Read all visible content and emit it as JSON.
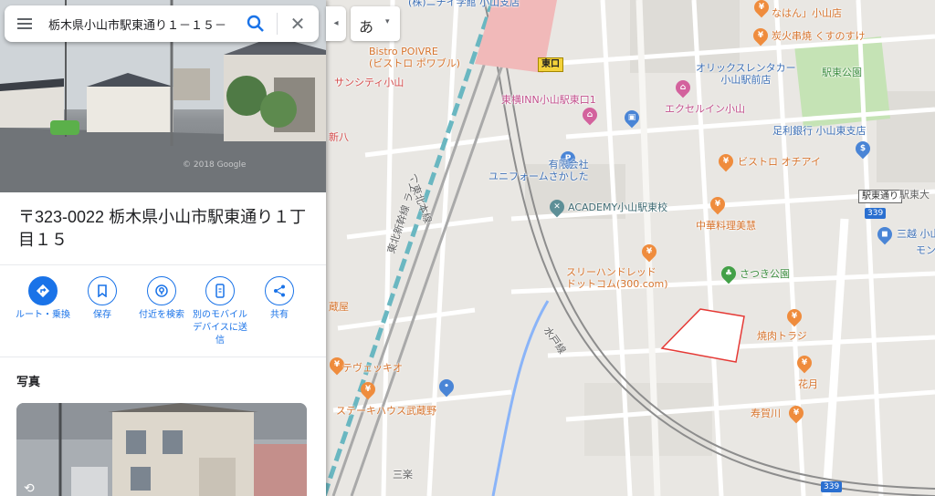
{
  "search": {
    "value": "栃木県小山市駅東通り１－１５－",
    "clear": "✕"
  },
  "ime": {
    "label": "あ",
    "caret": "▾"
  },
  "collapse": {
    "label": "◂"
  },
  "place": {
    "address": "〒323-0022 栃木県小山市駅東通り１丁目１５"
  },
  "actions": [
    {
      "label": "ルート・乗換"
    },
    {
      "label": "保存"
    },
    {
      "label": "付近を検索"
    },
    {
      "label": "別のモバイルデバイスに送信"
    },
    {
      "label": "共有"
    }
  ],
  "photos": {
    "title": "写真"
  },
  "hero": {
    "watermark": "© 2018 Google"
  },
  "map": {
    "labels": {
      "station_exit": "東口",
      "station_east_street": "駅東通り",
      "station_east_street_clipped": "駅東大",
      "route_339": "339",
      "route_339_b": "339",
      "tohoku_main_line": "東北本線",
      "tohoku_shinkansen": "東北新幹線 ライン",
      "mito_line": "水戸線",
      "sanraku": "三楽",
      "shinpachi": "新八",
      "kura": "蔵屋"
    },
    "pois": [
      {
        "name": "(株)ニチイ学館 小山支店",
        "kind": "shop"
      },
      {
        "name": "Bistro POIVRE\n(ビストロ ポワブル)",
        "kind": "food"
      },
      {
        "name": "サンシティ小山",
        "kind": "rail"
      },
      {
        "name": "東横INN小山駅東口1",
        "kind": "hotel"
      },
      {
        "name": "有限会社\nユニフォームさかした",
        "kind": "shop"
      },
      {
        "name": "ACADEMY小山駅東校",
        "kind": "school"
      },
      {
        "name": "スリーハンドレッド\nドットコム(300.com)",
        "kind": "food"
      },
      {
        "name": "テヴェッキオ",
        "kind": "food"
      },
      {
        "name": "ステーキハウス武蔵野",
        "kind": "food"
      },
      {
        "name": "オリックスレンタカー\n小山駅前店",
        "kind": "shop"
      },
      {
        "name": "エクセルイン小山",
        "kind": "hotel"
      },
      {
        "name": "足利銀行 小山東支店",
        "kind": "shop"
      },
      {
        "name": "ビストロ オチアイ",
        "kind": "food"
      },
      {
        "name": "中華料理美慧",
        "kind": "food"
      },
      {
        "name": "三越 小山",
        "kind": "shop"
      },
      {
        "name": "さつき公園",
        "kind": "park"
      },
      {
        "name": "焼肉トラジ",
        "kind": "food"
      },
      {
        "name": "花月",
        "kind": "food"
      },
      {
        "name": "寿賀川",
        "kind": "food"
      },
      {
        "name": "炭火串焼 くすのすけ",
        "kind": "food"
      },
      {
        "name": "駅東公園",
        "kind": "park"
      },
      {
        "name": "なはん」小山店",
        "kind": "food"
      },
      {
        "name": "モン",
        "kind": "shop"
      }
    ]
  },
  "colors": {
    "accent": "#1a73e8",
    "food": "#ef8c3d",
    "shop": "#4a85d6",
    "hotel": "#d3629d",
    "park": "#43a047"
  }
}
